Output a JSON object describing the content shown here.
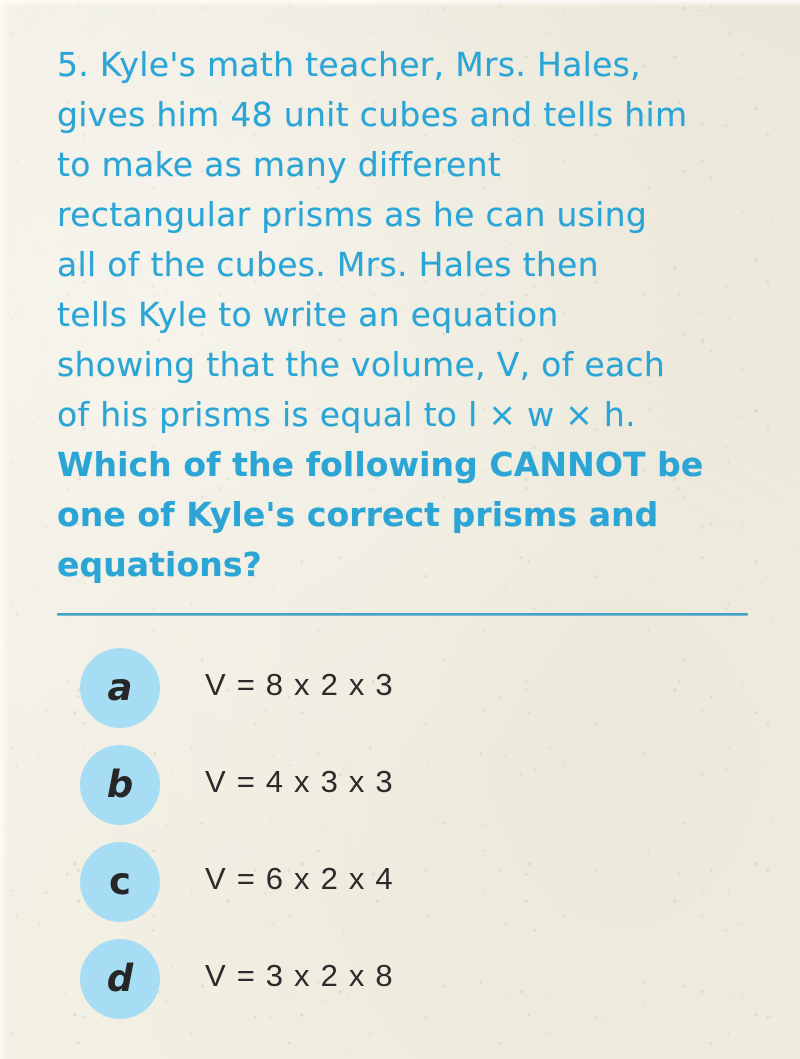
{
  "page": {
    "background_color": "#f2efe3",
    "accent_teal": "#2aa5d6",
    "badge_blue": "#a7ddf4",
    "equation_color": "#2b2b2b"
  },
  "question": {
    "number": "5.",
    "lines": [
      {
        "text": "5. Kyle's math teacher, Mrs. Hales,",
        "emphasis": false
      },
      {
        "text": "gives him 48 unit cubes and tells him",
        "emphasis": false
      },
      {
        "text": "to make as many different",
        "emphasis": false
      },
      {
        "text": "rectangular prisms as he can using",
        "emphasis": false
      },
      {
        "text": "all of the cubes. Mrs. Hales then",
        "emphasis": false
      },
      {
        "text": "tells Kyle to write an equation",
        "emphasis": false
      },
      {
        "text": "showing that the volume, V, of each",
        "emphasis": false
      },
      {
        "text": "of his prisms is equal to l × w × h.",
        "emphasis": false
      },
      {
        "text": "Which of the following CANNOT be",
        "emphasis": true
      },
      {
        "text": "one of Kyle's correct prisms and",
        "emphasis": true
      },
      {
        "text": "equations?",
        "emphasis": true
      }
    ],
    "full_text": "5. Kyle's math teacher, Mrs. Hales, gives him 48 unit cubes and tells him to make as many different rectangular prisms as he can using all of the cubes. Mrs. Hales then tells Kyle to write an equation showing that the volume, V, of each of his prisms is equal to l × w × h. Which of the following CANNOT be one of Kyle's correct prisms and equations?"
  },
  "options": [
    {
      "letter": "a",
      "equation": "V = 8 x 2 x 3",
      "italic": true
    },
    {
      "letter": "b",
      "equation": "V = 4 x 3 x 3",
      "italic": true
    },
    {
      "letter": "c",
      "equation": "V = 6 x 2 x 4",
      "italic": false
    },
    {
      "letter": "d",
      "equation": "V = 3 x 2 x 8",
      "italic": true
    }
  ]
}
